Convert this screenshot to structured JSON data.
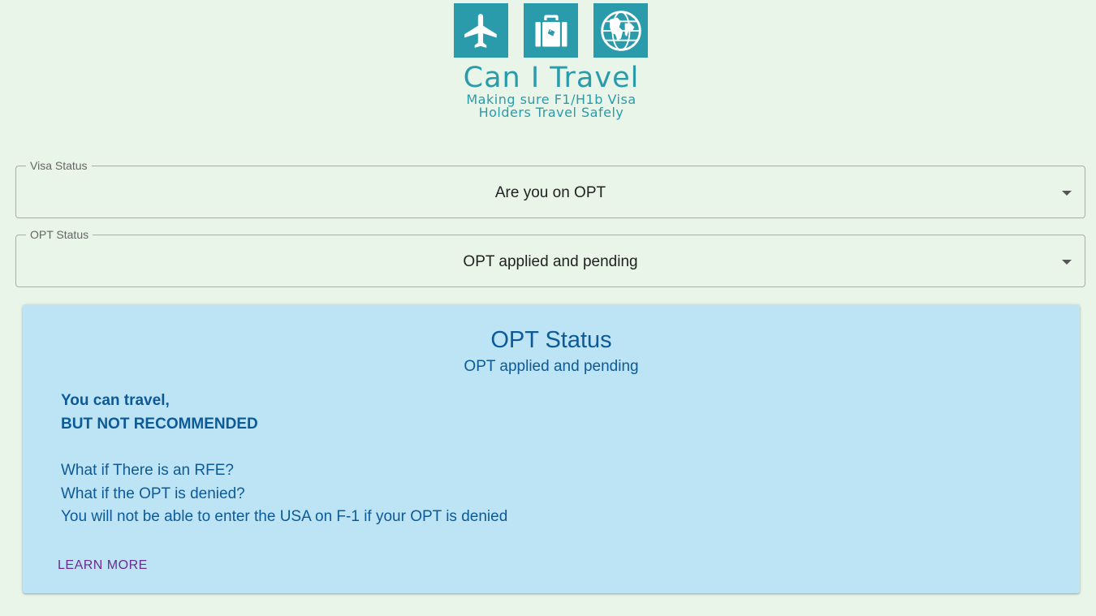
{
  "logo": {
    "title": "Can I Travel",
    "subtitle_line1": "Making sure F1/H1b Visa",
    "subtitle_line2": "Holders Travel Safely",
    "icons": [
      "airplane-icon",
      "suitcase-icon",
      "globe-icon"
    ],
    "color": "#2a9bab"
  },
  "visa_field": {
    "label": "Visa Status",
    "value": "Are you on OPT"
  },
  "opt_field": {
    "label": "OPT Status",
    "value": "OPT applied and pending"
  },
  "card": {
    "title": "OPT Status",
    "subtitle": "OPT applied and pending",
    "verdict_line1": "You can travel,",
    "verdict_line2": "BUT NOT RECOMMENDED",
    "notes": [
      "What if There is an RFE?",
      "What if the OPT is denied?",
      "You will not be able to enter the USA on F-1 if your OPT is denied"
    ],
    "learn_more": "LEARN MORE",
    "background": "#bce4f5",
    "text_color": "#0d5a96"
  }
}
